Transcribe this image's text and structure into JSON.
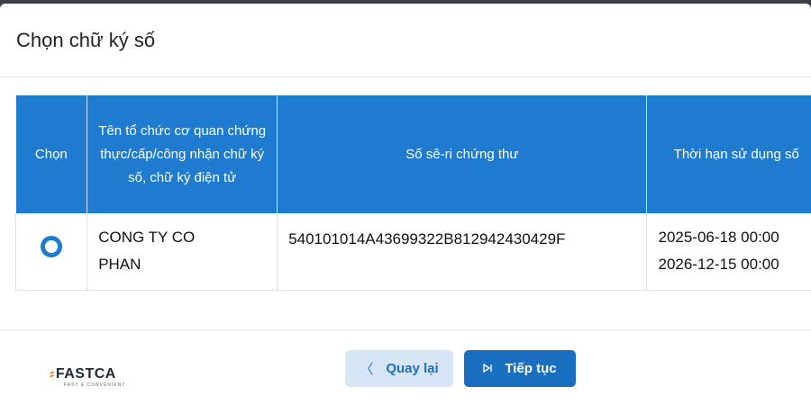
{
  "dialog": {
    "title": "Chọn chữ ký số"
  },
  "table": {
    "headers": [
      "Chọn",
      "Tên tổ chức cơ quan chứng thực/cấp/công nhận chữ ký số, chữ ký điện tử",
      "Số sê-ri chứng thư",
      "Thời hạn sử dụng số"
    ],
    "rows": [
      {
        "selected": true,
        "org_line1": "CONG TY CO",
        "org_line2": "PHAN",
        "serial": "540101014A43699322B812942430429F",
        "valid_from": "2025-06-18 00:00",
        "valid_to": "2026-12-15 00:00"
      }
    ]
  },
  "footer": {
    "logo_text": "FASTCA",
    "logo_tagline": "FAST & CONVENIENT",
    "back_label": "Quay lại",
    "next_label": "Tiếp tục",
    "back_icon": "chevron-left-icon",
    "next_icon": "skip-next-icon"
  },
  "colors": {
    "header_bg": "#1e7bd0",
    "primary_button": "#1a6ec0",
    "secondary_button": "#d6e6f6",
    "logo_accent": "#f07a1a"
  }
}
